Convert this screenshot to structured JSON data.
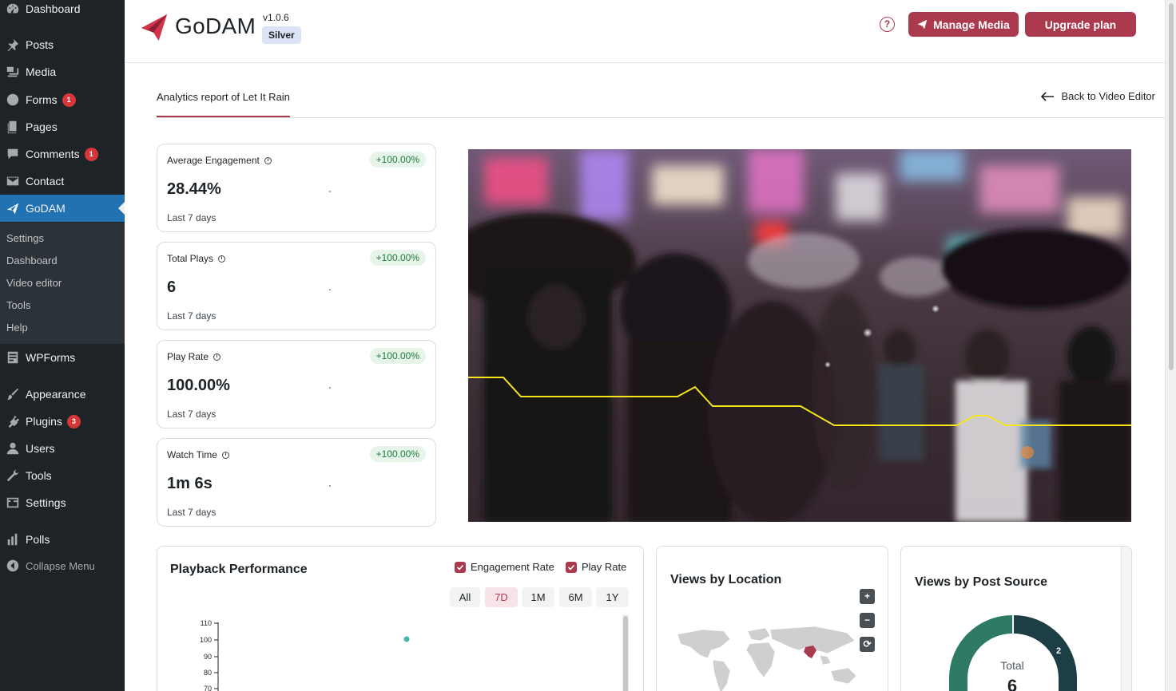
{
  "sidebar": {
    "items": [
      {
        "label": "Dashboard",
        "icon": "dashboard-icon"
      },
      {
        "label": "Posts",
        "icon": "pin-icon"
      },
      {
        "label": "Media",
        "icon": "media-icon"
      },
      {
        "label": "Forms",
        "icon": "forms-icon",
        "badge": "1"
      },
      {
        "label": "Pages",
        "icon": "pages-icon"
      },
      {
        "label": "Comments",
        "icon": "comment-icon",
        "badge": "1"
      },
      {
        "label": "Contact",
        "icon": "mail-icon"
      },
      {
        "label": "GoDAM",
        "icon": "godam-icon"
      },
      {
        "label": "WPForms",
        "icon": "wpforms-icon"
      },
      {
        "label": "Appearance",
        "icon": "brush-icon"
      },
      {
        "label": "Plugins",
        "icon": "plugin-icon",
        "badge": "3"
      },
      {
        "label": "Users",
        "icon": "user-icon"
      },
      {
        "label": "Tools",
        "icon": "wrench-icon"
      },
      {
        "label": "Settings",
        "icon": "settings-icon"
      },
      {
        "label": "Polls",
        "icon": "bar-chart-icon"
      },
      {
        "label": "Collapse Menu",
        "icon": "collapse-icon"
      }
    ],
    "submenu": [
      "Settings",
      "Dashboard",
      "Video editor",
      "Tools",
      "Help"
    ]
  },
  "header": {
    "brand": "GoDAM",
    "version": "v1.0.6",
    "plan": "Silver",
    "manage_label": "Manage Media",
    "upgrade_label": "Upgrade plan"
  },
  "tabs": {
    "report_label": "Analytics report of Let It Rain",
    "back_label": "Back to Video Editor"
  },
  "cards": [
    {
      "title": "Average Engagement",
      "change": "+100.00%",
      "value": "28.44%",
      "period": "Last 7 days"
    },
    {
      "title": "Total Plays",
      "change": "+100.00%",
      "value": "6",
      "period": "Last 7 days"
    },
    {
      "title": "Play Rate",
      "change": "+100.00%",
      "value": "100.00%",
      "period": "Last 7 days"
    },
    {
      "title": "Watch Time",
      "change": "+100.00%",
      "value": "1m 6s",
      "period": "Last 7 days"
    }
  ],
  "playback": {
    "title": "Playback Performance",
    "legend": [
      "Engagement Rate",
      "Play Rate"
    ],
    "ranges": [
      "All",
      "7D",
      "1M",
      "6M",
      "1Y"
    ],
    "selected_range": "7D",
    "y_ticks": [
      "110",
      "100",
      "90",
      "80",
      "70"
    ]
  },
  "location": {
    "title": "Views by Location",
    "zoom_in": "+",
    "zoom_out": "−",
    "reset": "⟳"
  },
  "postsource": {
    "title": "Views by Post Source",
    "center_label": "Total",
    "center_value": "6",
    "segment_label": "2"
  },
  "colors": {
    "accent": "#ab3a4f",
    "wp_admin_bg": "#1d2327",
    "wp_active": "#2271b1",
    "positive_bg": "#e6f4ea",
    "positive_text": "#1e7b3d",
    "heatmap_line": "#f4e61a"
  }
}
